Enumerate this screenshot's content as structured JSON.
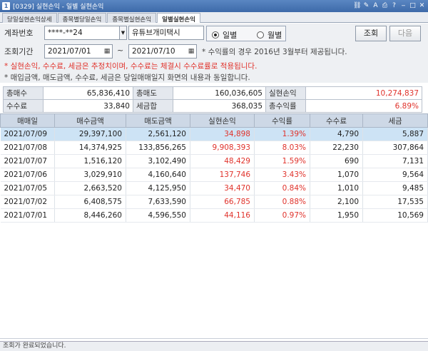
{
  "window": {
    "title": "[0329] 실현손익 - 일별 실현손익",
    "icon": "1"
  },
  "tabs": [
    "당일실현손익상세",
    "종목별당일손익",
    "종목별실현손익",
    "일별실현손익"
  ],
  "form": {
    "account_label": "계좌번호",
    "account_value": "****-**24",
    "account_name": "유튜브개미택시",
    "radio_daily": "일별",
    "radio_monthly": "월별",
    "query_button": "조회",
    "next_button": "다음",
    "period_label": "조회기간",
    "date_from": "2021/07/01",
    "tilde": "~",
    "date_to": "2021/07/10",
    "note_period": "* 수익률의 경우 2016년 3월부터 제공됩니다.",
    "note_red": "* 실현손익, 수수료, 세금은 추정치이며, 수수료는 체결시 수수료률로 적용됩니다.",
    "note_gray": "* 매입금액, 매도금액, 수수료, 세금은 당일매매일지 화면의 내용과 동일합니다."
  },
  "summary": {
    "total_buy_label": "총매수",
    "total_buy": "65,836,410",
    "total_sell_label": "총매도",
    "total_sell": "160,036,605",
    "realized_label": "실현손익",
    "realized": "10,274,837",
    "fee_label": "수수료",
    "fee": "33,840",
    "tax_label": "세금합",
    "tax": "368,035",
    "return_label": "총수익률",
    "return": "6.89%"
  },
  "grid": {
    "columns": [
      "매매일",
      "매수금액",
      "매도금액",
      "실현손익",
      "수익률",
      "수수료",
      "세금"
    ],
    "rows": [
      [
        "2021/07/09",
        "29,397,100",
        "2,561,120",
        "34,898",
        "1.39%",
        "4,790",
        "5,887"
      ],
      [
        "2021/07/08",
        "14,374,925",
        "133,856,265",
        "9,908,393",
        "8.03%",
        "22,230",
        "307,864"
      ],
      [
        "2021/07/07",
        "1,516,120",
        "3,102,490",
        "48,429",
        "1.59%",
        "690",
        "7,131"
      ],
      [
        "2021/07/06",
        "3,029,910",
        "4,160,640",
        "137,746",
        "3.43%",
        "1,070",
        "9,564"
      ],
      [
        "2021/07/05",
        "2,663,520",
        "4,125,950",
        "34,470",
        "0.84%",
        "1,010",
        "9,485"
      ],
      [
        "2021/07/02",
        "6,408,575",
        "7,633,590",
        "66,785",
        "0.88%",
        "2,100",
        "17,535"
      ],
      [
        "2021/07/01",
        "8,446,260",
        "4,596,550",
        "44,116",
        "0.97%",
        "1,950",
        "10,569"
      ]
    ]
  },
  "status": "조회가 완료되었습니다.",
  "colors": {
    "profit": "#e0322b",
    "selected_row": "#cde3f5",
    "title_bar": "#3d6aa9"
  }
}
